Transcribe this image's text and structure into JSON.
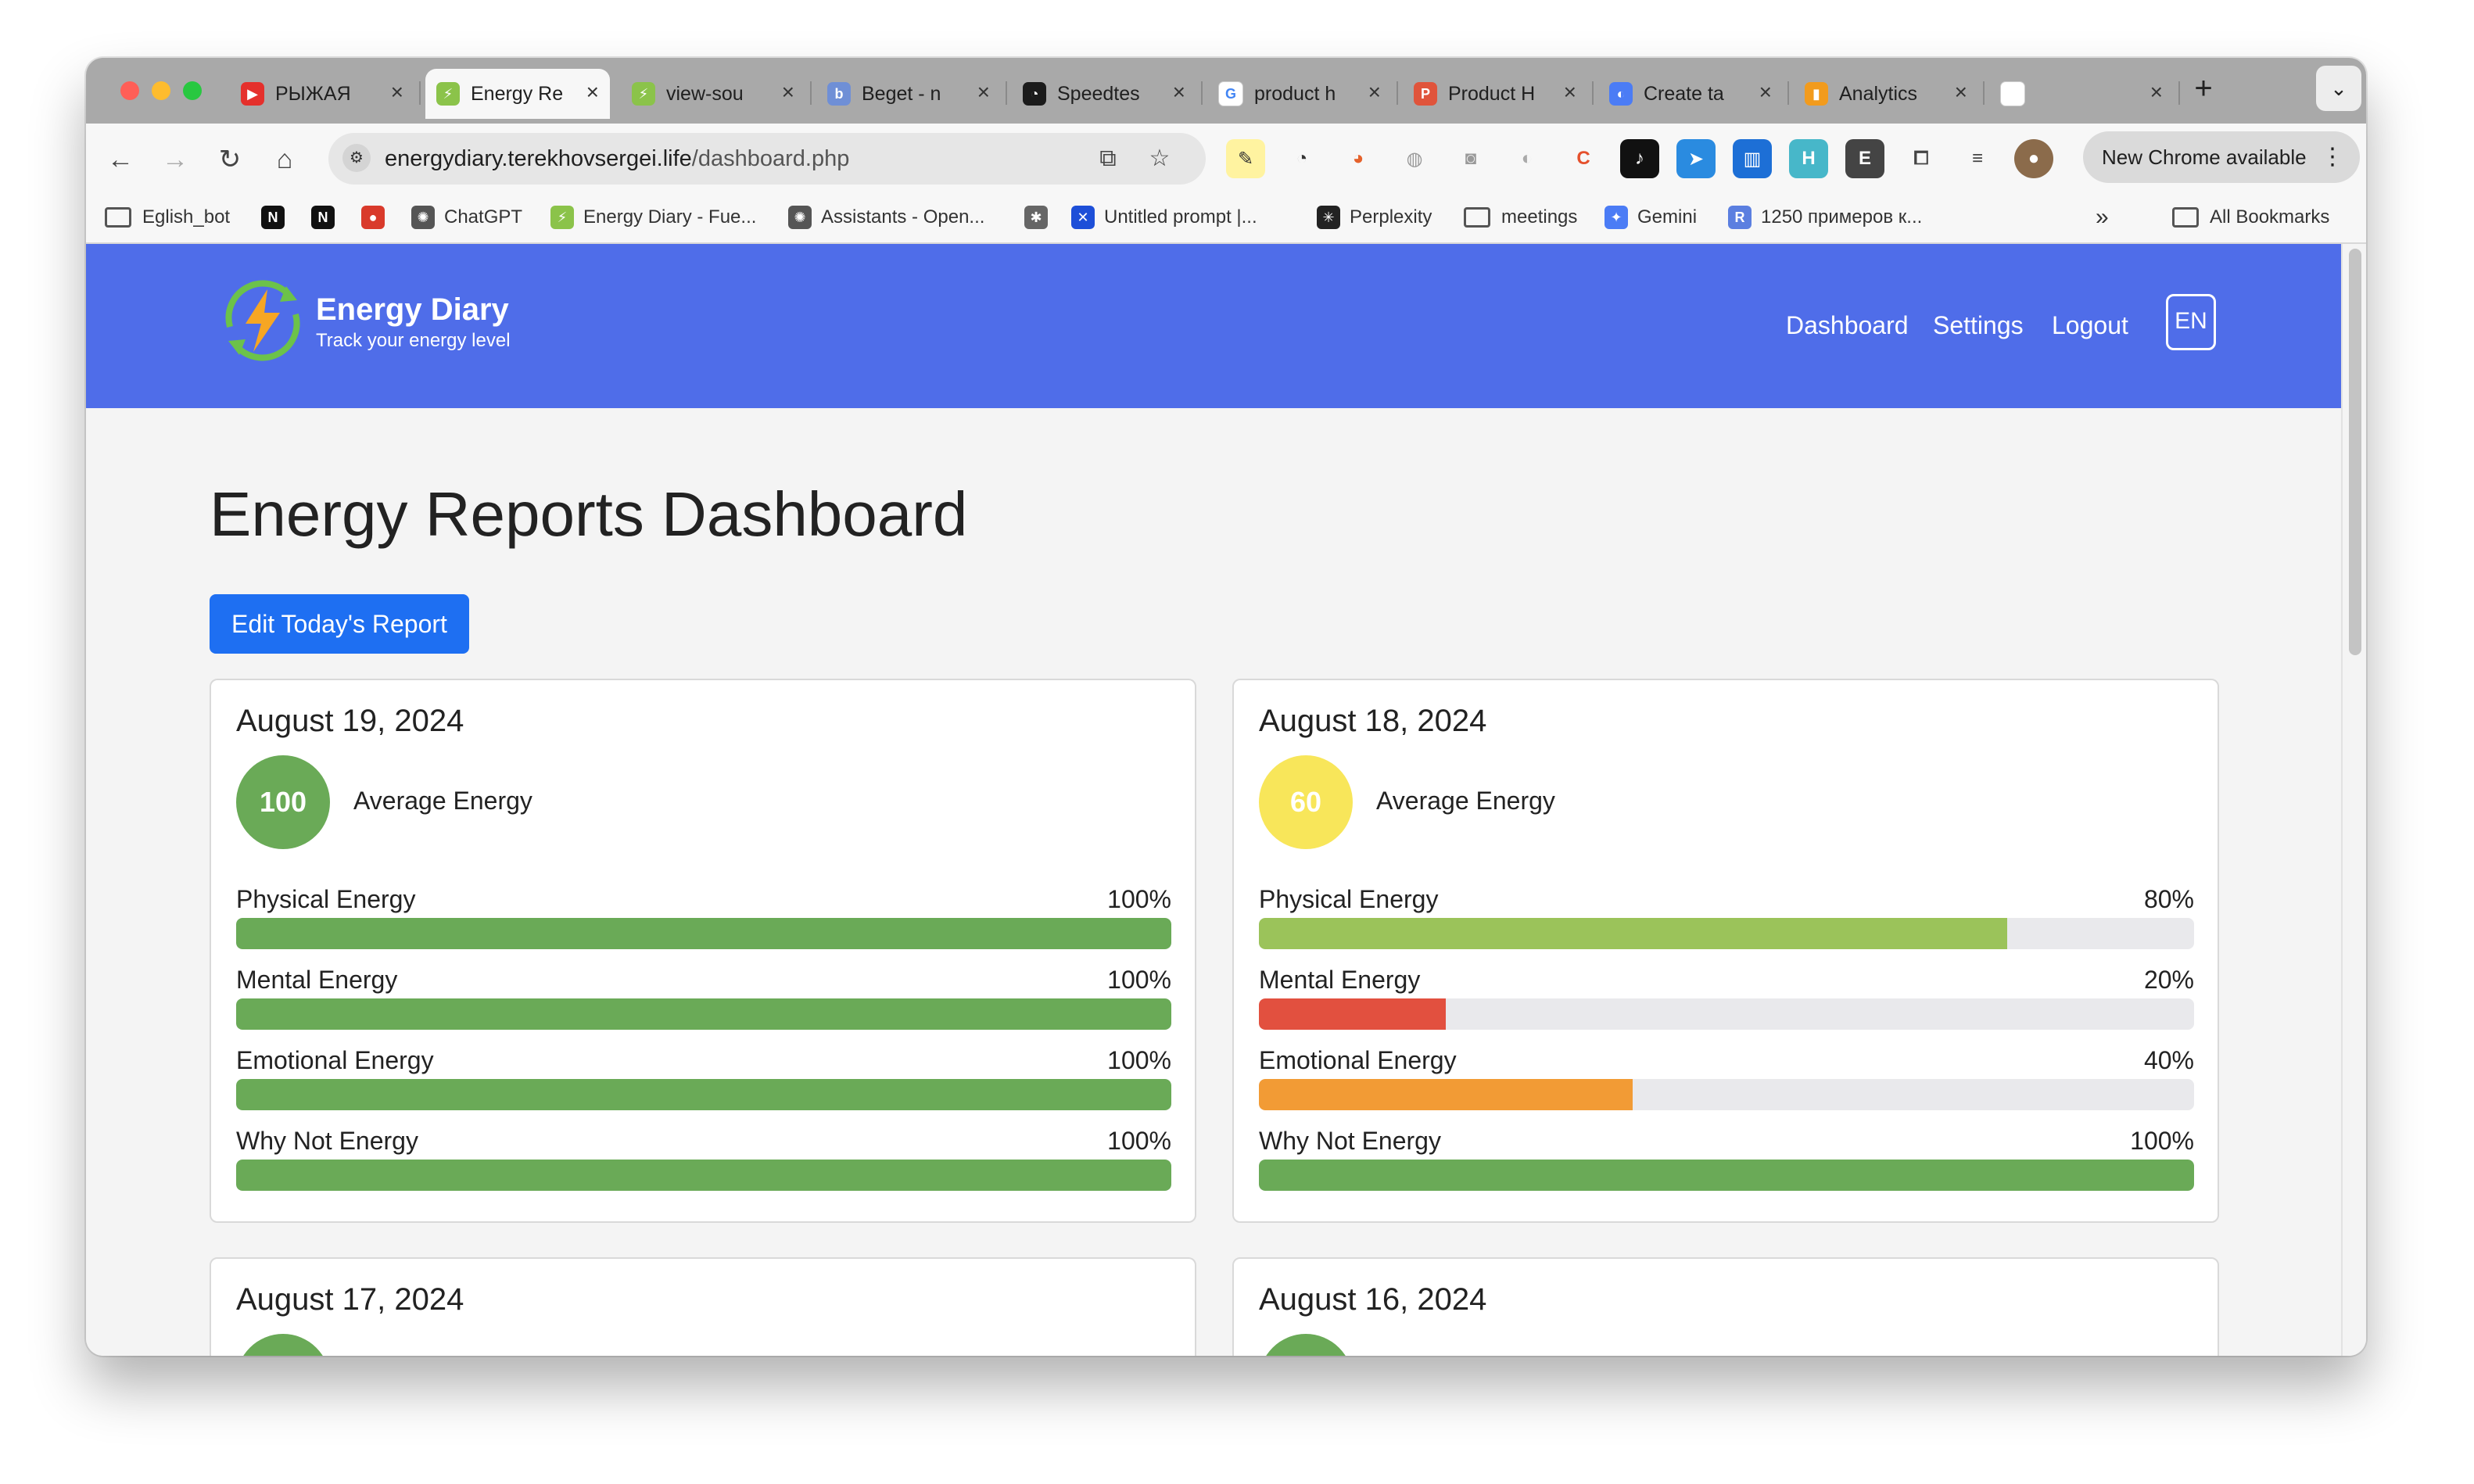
{
  "browser": {
    "tabs": [
      {
        "title": "РЫЖАЯ",
        "icon": "youtube-icon",
        "color": "#e5302c",
        "glyph": "▶",
        "active": false
      },
      {
        "title": "Energy Re",
        "icon": "energy-diary-favicon",
        "color": "#8bc34a",
        "glyph": "⚡",
        "active": true
      },
      {
        "title": "view-sou",
        "icon": "globe-icon",
        "color": "#8bc34a",
        "glyph": "⚡",
        "active": false
      },
      {
        "title": "Beget - n",
        "icon": "beget-icon",
        "color": "#6f8fd6",
        "glyph": "b",
        "active": false
      },
      {
        "title": "Speedtes",
        "icon": "speedtest-icon",
        "color": "#1b1b1b",
        "glyph": "◔",
        "active": false
      },
      {
        "title": "product h",
        "icon": "google-icon",
        "color": "#ffffff",
        "glyph": "G",
        "active": false
      },
      {
        "title": "Product H",
        "icon": "producthunt-icon",
        "color": "#e0543b",
        "glyph": "P",
        "active": false
      },
      {
        "title": "Create ta",
        "icon": "gemini-icon",
        "color": "#4b7cf5",
        "glyph": "◐",
        "active": false
      },
      {
        "title": "Analytics",
        "icon": "analytics-icon",
        "color": "#f29b1d",
        "glyph": "▮",
        "active": false
      },
      {
        "title": "",
        "icon": "blank-page-icon",
        "color": "#ffffff",
        "glyph": "",
        "active": false
      }
    ],
    "url_host": "energydiary.terekhovsergei.life",
    "url_path": "/dashboard.php",
    "update_label": "New Chrome available",
    "bookmarks": [
      {
        "label": "Eglish_bot",
        "icon": "folder-icon"
      },
      {
        "label": "",
        "icon": "notion-icon"
      },
      {
        "label": "",
        "icon": "notion-icon"
      },
      {
        "label": "",
        "icon": "app-icon"
      },
      {
        "label": "ChatGPT",
        "icon": "openai-icon"
      },
      {
        "label": "Energy Diary - Fue...",
        "icon": "energy-diary-favicon"
      },
      {
        "label": "Assistants - Open...",
        "icon": "openai-icon"
      },
      {
        "label": "",
        "icon": "bot-icon"
      },
      {
        "label": "Untitled prompt |...",
        "icon": "butterfly-icon"
      },
      {
        "label": "Perplexity",
        "icon": "perplexity-icon"
      },
      {
        "label": "meetings",
        "icon": "folder-icon"
      },
      {
        "label": "Gemini",
        "icon": "gemini-spark-icon"
      },
      {
        "label": "1250 примеров к...",
        "icon": "r-icon"
      }
    ],
    "bookmarks_more": "»",
    "all_bookmarks": "All Bookmarks"
  },
  "site": {
    "brand_title": "Energy Diary",
    "brand_tagline": "Track your energy level",
    "nav": [
      "Dashboard",
      "Settings",
      "Logout"
    ],
    "lang": "EN"
  },
  "page": {
    "title": "Energy Reports Dashboard",
    "edit_button": "Edit Today's Report",
    "avg_label": "Average Energy"
  },
  "reports": [
    {
      "date": "August 19, 2024",
      "average": "100",
      "average_color": "#6aaa57",
      "metrics": [
        {
          "name": "Physical Energy",
          "value_text": "100%",
          "percent": 100,
          "color": "#6aaa57"
        },
        {
          "name": "Mental Energy",
          "value_text": "100%",
          "percent": 100,
          "color": "#6aaa57"
        },
        {
          "name": "Emotional Energy",
          "value_text": "100%",
          "percent": 100,
          "color": "#6aaa57"
        },
        {
          "name": "Why Not Energy",
          "value_text": "100%",
          "percent": 100,
          "color": "#6aaa57"
        }
      ]
    },
    {
      "date": "August 18, 2024",
      "average": "60",
      "average_color": "#f8e65a",
      "metrics": [
        {
          "name": "Physical Energy",
          "value_text": "80%",
          "percent": 80,
          "color": "#9bc35a"
        },
        {
          "name": "Mental Energy",
          "value_text": "20%",
          "percent": 20,
          "color": "#e2503f"
        },
        {
          "name": "Emotional Energy",
          "value_text": "40%",
          "percent": 40,
          "color": "#f29b35"
        },
        {
          "name": "Why Not Energy",
          "value_text": "100%",
          "percent": 100,
          "color": "#6aaa57"
        }
      ]
    },
    {
      "date": "August 17, 2024",
      "average_color": "#6aaa57"
    },
    {
      "date": "August 16, 2024",
      "average_color": "#6aaa57"
    }
  ]
}
